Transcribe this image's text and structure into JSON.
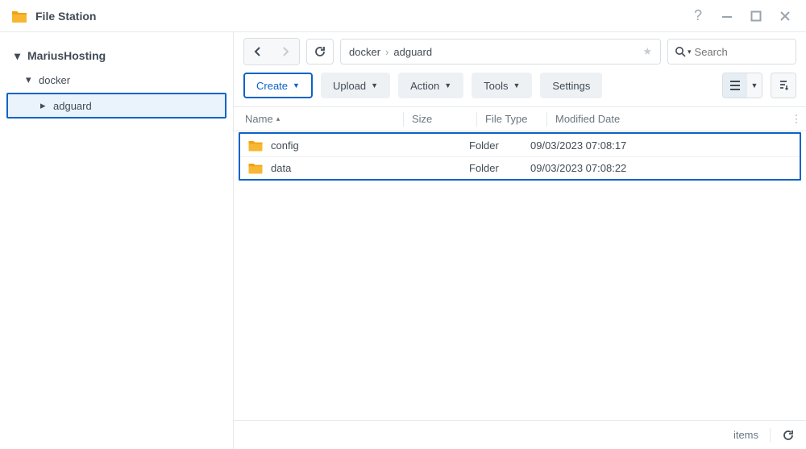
{
  "app": {
    "title": "File Station"
  },
  "sidebar": {
    "root": "MariusHosting",
    "items": [
      {
        "label": "docker"
      },
      {
        "label": "adguard"
      }
    ]
  },
  "breadcrumb": {
    "segments": [
      "docker",
      "adguard"
    ]
  },
  "search": {
    "placeholder": "Search"
  },
  "actions": {
    "create": "Create",
    "upload": "Upload",
    "action": "Action",
    "tools": "Tools",
    "settings": "Settings"
  },
  "columns": {
    "name": "Name",
    "size": "Size",
    "filetype": "File Type",
    "modified": "Modified Date"
  },
  "rows": [
    {
      "name": "config",
      "size": "",
      "type": "Folder",
      "date": "09/03/2023 07:08:17"
    },
    {
      "name": "data",
      "size": "",
      "type": "Folder",
      "date": "09/03/2023 07:08:22"
    }
  ],
  "status": {
    "items_label": "items"
  }
}
